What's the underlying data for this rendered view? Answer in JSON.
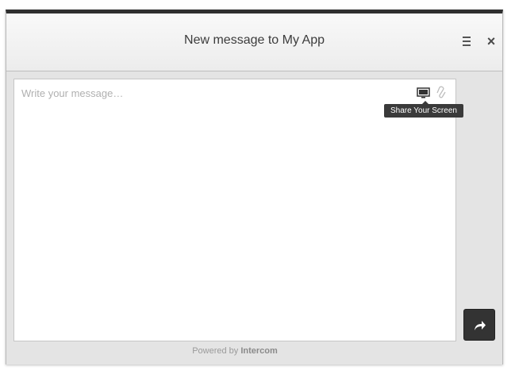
{
  "header": {
    "title": "New message to My App",
    "menu_icon": "hamburger-icon",
    "close_label": "×"
  },
  "composer": {
    "placeholder": "Write your message…",
    "value": "",
    "tools": [
      {
        "icon": "monitor-screen-icon",
        "tooltip": "Share Your Screen"
      },
      {
        "icon": "paperclip-icon"
      }
    ]
  },
  "send_button": {
    "icon": "share-arrow-icon"
  },
  "footer": {
    "prefix": "Powered by",
    "brand": "Intercom"
  },
  "colors": {
    "header_bar": "#2f2f2f",
    "send_button": "#333333",
    "tooltip_bg": "#3a3a3a"
  }
}
